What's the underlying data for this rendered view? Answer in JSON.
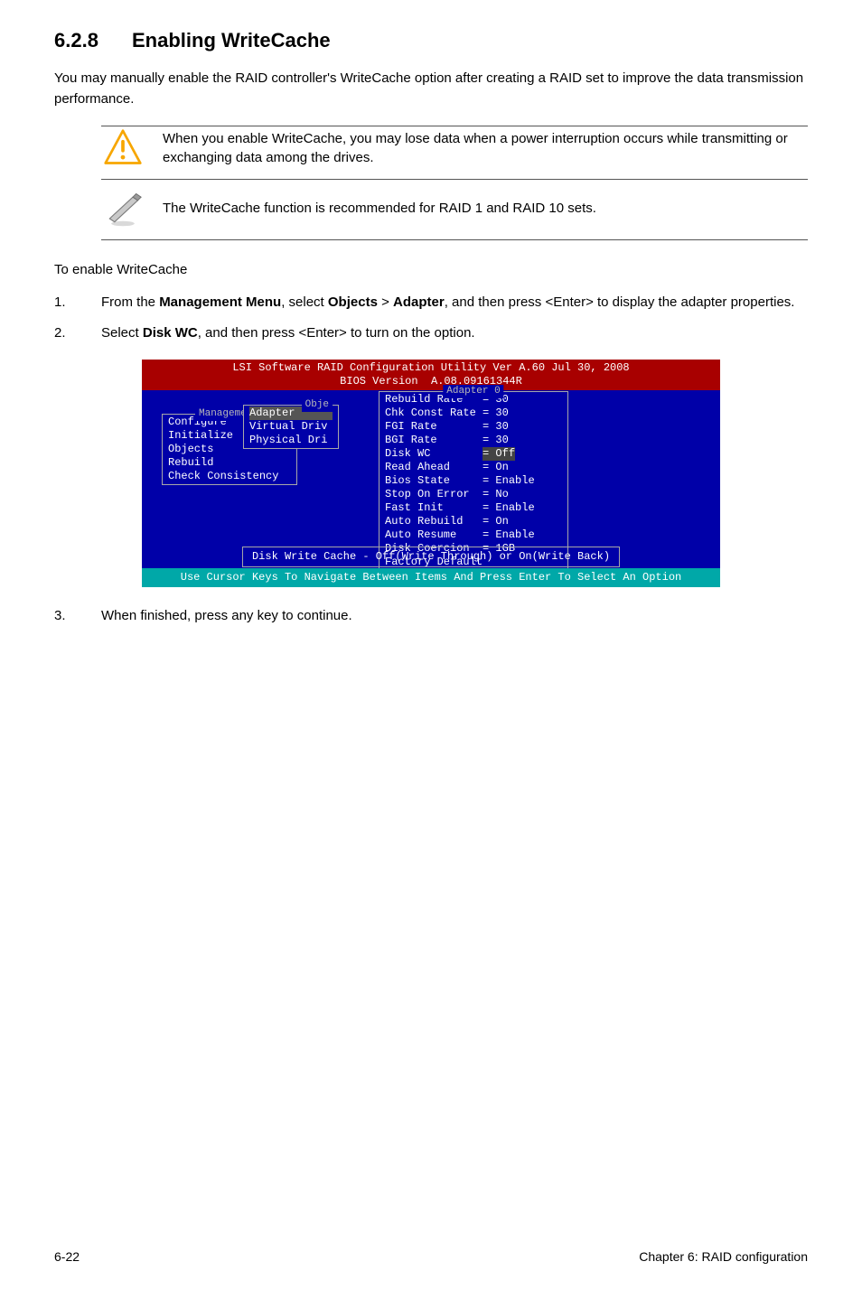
{
  "heading": {
    "num": "6.2.8",
    "title": "Enabling WriteCache"
  },
  "intro": "You may manually enable the RAID controller's WriteCache option after creating a RAID set to improve the data transmission performance.",
  "warningNote": "When you enable WriteCache, you may lose data when a power interruption occurs while transmitting or exchanging data among the drives.",
  "infoNote": "The WriteCache function is recommended for RAID 1 and RAID 10 sets.",
  "subHeading": "To enable WriteCache",
  "steps": [
    {
      "n": "1.",
      "pre": "From the ",
      "b1": "Management Menu",
      "mid1": ", select ",
      "b2": "Objects",
      "mid2": " > ",
      "b3": "Adapter",
      "post": ", and then press <Enter> to display the adapter properties."
    },
    {
      "n": "2.",
      "pre": "Select ",
      "b1": "Disk WC",
      "mid1": ", and then press <Enter> to turn on the option.",
      "b2": "",
      "mid2": "",
      "b3": "",
      "post": ""
    },
    {
      "n": "3.",
      "pre": "When finished, press any key to continue.",
      "b1": "",
      "mid1": "",
      "b2": "",
      "mid2": "",
      "b3": "",
      "post": ""
    }
  ],
  "bios": {
    "title1": "LSI Software RAID Configuration Utility Ver A.60 Jul 30, 2008",
    "title2": "BIOS Version  A.08.09161344R",
    "mgmtPanel": {
      "label": "Management",
      "items": [
        "Configure",
        "Initialize",
        "Objects",
        "Rebuild",
        "Check Consistency"
      ]
    },
    "objePanel": {
      "label": "Obje",
      "items": [
        "Adapter",
        "Virtual Driv",
        "Physical Dri"
      ]
    },
    "adapterPanel": {
      "label": "Adapter 0",
      "rows": [
        {
          "k": "Rebuild Rate",
          "v": "= 30"
        },
        {
          "k": "Chk Const Rate",
          "v": "= 30"
        },
        {
          "k": "FGI Rate",
          "v": "= 30"
        },
        {
          "k": "BGI Rate",
          "v": "= 30"
        },
        {
          "k": "Disk WC",
          "v": "= Off",
          "sel": true
        },
        {
          "k": "Read Ahead",
          "v": "= On"
        },
        {
          "k": "Bios State",
          "v": "= Enable"
        },
        {
          "k": "Stop On Error",
          "v": "= No"
        },
        {
          "k": "Fast Init",
          "v": "= Enable"
        },
        {
          "k": "Auto Rebuild",
          "v": "= On"
        },
        {
          "k": "Auto Resume",
          "v": "= Enable"
        },
        {
          "k": "Disk Coercion",
          "v": "= 1GB"
        },
        {
          "k": "Factory Default",
          "v": ""
        }
      ]
    },
    "hint": "Disk Write Cache - Off(Write Through) or On(Write Back)",
    "footer": "Use Cursor Keys To Navigate Between Items And Press Enter To Select An Option"
  },
  "footer": {
    "left": "6-22",
    "right": "Chapter 6: RAID configuration"
  },
  "icons": {
    "warning": "warning-icon",
    "note": "note-icon"
  }
}
